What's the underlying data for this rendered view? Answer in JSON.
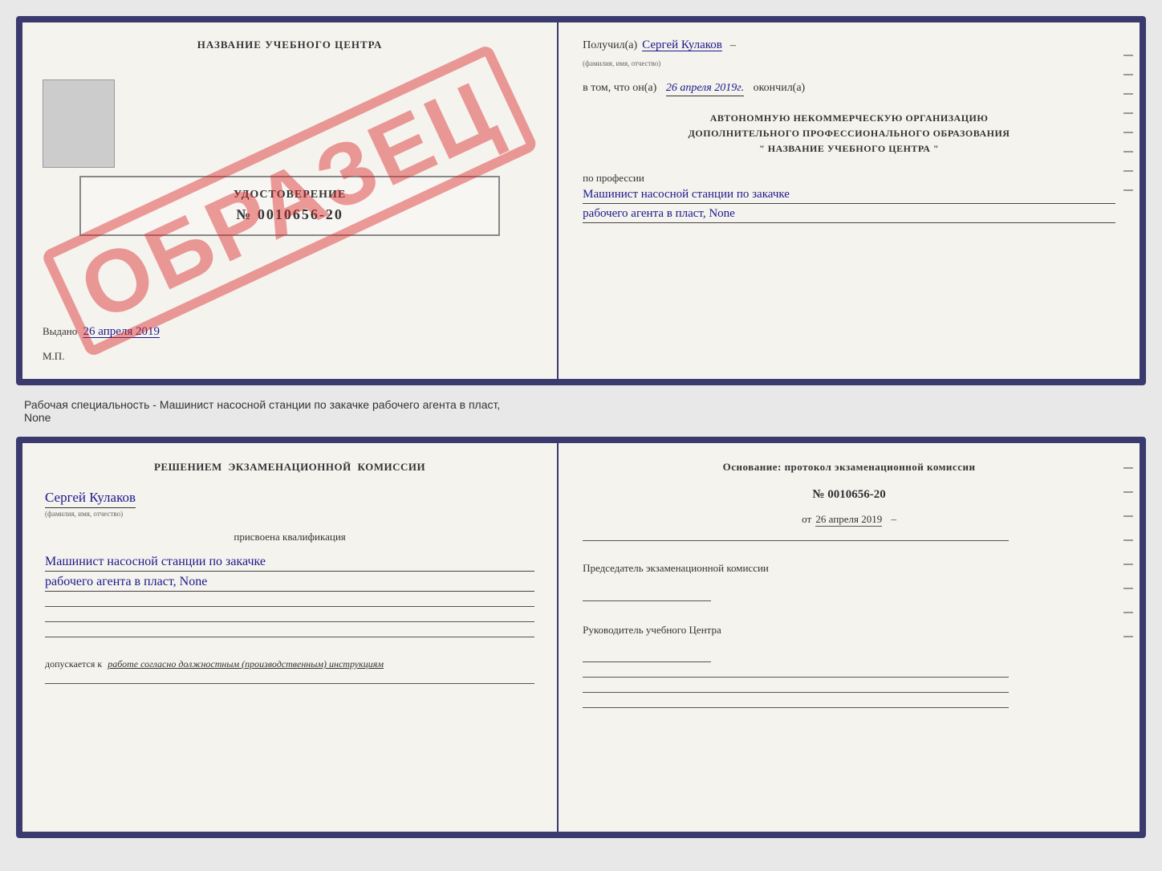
{
  "topDoc": {
    "left": {
      "centerTitle": "НАЗВАНИЕ УЧЕБНОГО ЦЕНТРА",
      "stampText": "ОБРАЗЕЦ",
      "certTitle": "УДОСТОВЕРЕНИЕ",
      "certNumber": "№ 0010656-20",
      "issuedLabel": "Выдано",
      "issuedDate": "26 апреля 2019",
      "mpLabel": "М.П."
    },
    "right": {
      "receivedLabel": "Получил(а)",
      "receivedName": "Сергей Кулаков",
      "nameSubLabel": "(фамилия, имя, отчество)",
      "inThatLabel": "в том, что он(а)",
      "date": "26 апреля 2019г.",
      "finishedLabel": "окончил(а)",
      "orgLine1": "АВТОНОМНУЮ НЕКОММЕРЧЕСКУЮ ОРГАНИЗАЦИЮ",
      "orgLine2": "ДОПОЛНИТЕЛЬНОГО ПРОФЕССИОНАЛЬНОГО ОБРАЗОВАНИЯ",
      "orgLine3": "\" НАЗВАНИЕ УЧЕБНОГО ЦЕНТРА \"",
      "professionLabel": "по профессии",
      "professionLine1": "Машинист насосной станции по закачке",
      "professionLine2": "рабочего агента в пласт, None"
    }
  },
  "betweenText": "Рабочая специальность - Машинист насосной станции по закачке рабочего агента в пласт,\nNone",
  "bottomDoc": {
    "left": {
      "commissionTitle": "Решением экзаменационной комиссии",
      "personName": "Сергей Кулаков",
      "nameSubLabel": "(фамилия, имя, отчество)",
      "assignedLabel": "присвоена квалификация",
      "qualLine1": "Машинист насосной станции по закачке",
      "qualLine2": "рабочего агента в пласт, None",
      "allowedLabel": "допускается к",
      "allowedText": "работе согласно должностным (производственным) инструкциям"
    },
    "right": {
      "basisTitle": "Основание: протокол экзаменационной комиссии",
      "protocolNumber": "№ 0010656-20",
      "protocolDatePrefix": "от",
      "protocolDate": "26 апреля 2019",
      "chairmanLabel": "Председатель экзаменационной комиссии",
      "headLabel": "Руководитель учебного Центра"
    }
  }
}
